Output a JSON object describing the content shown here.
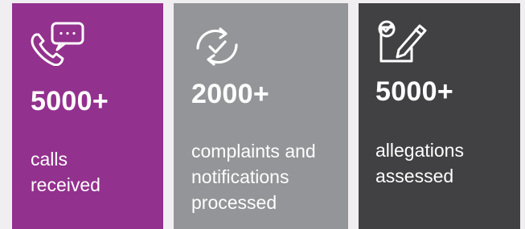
{
  "stats": [
    {
      "icon": "phone-chat-icon",
      "value": "5000+",
      "label_line1": "calls",
      "label_line2": "received",
      "label_line3": "",
      "color": "#93318e"
    },
    {
      "icon": "refresh-check-icon",
      "value": "2000+",
      "label_line1": "complaints and",
      "label_line2": "notifications",
      "label_line3": "processed",
      "color": "#939598"
    },
    {
      "icon": "checklist-pen-icon",
      "value": "5000+",
      "label_line1": "allegations",
      "label_line2": "assessed",
      "label_line3": "",
      "color": "#414042"
    }
  ]
}
